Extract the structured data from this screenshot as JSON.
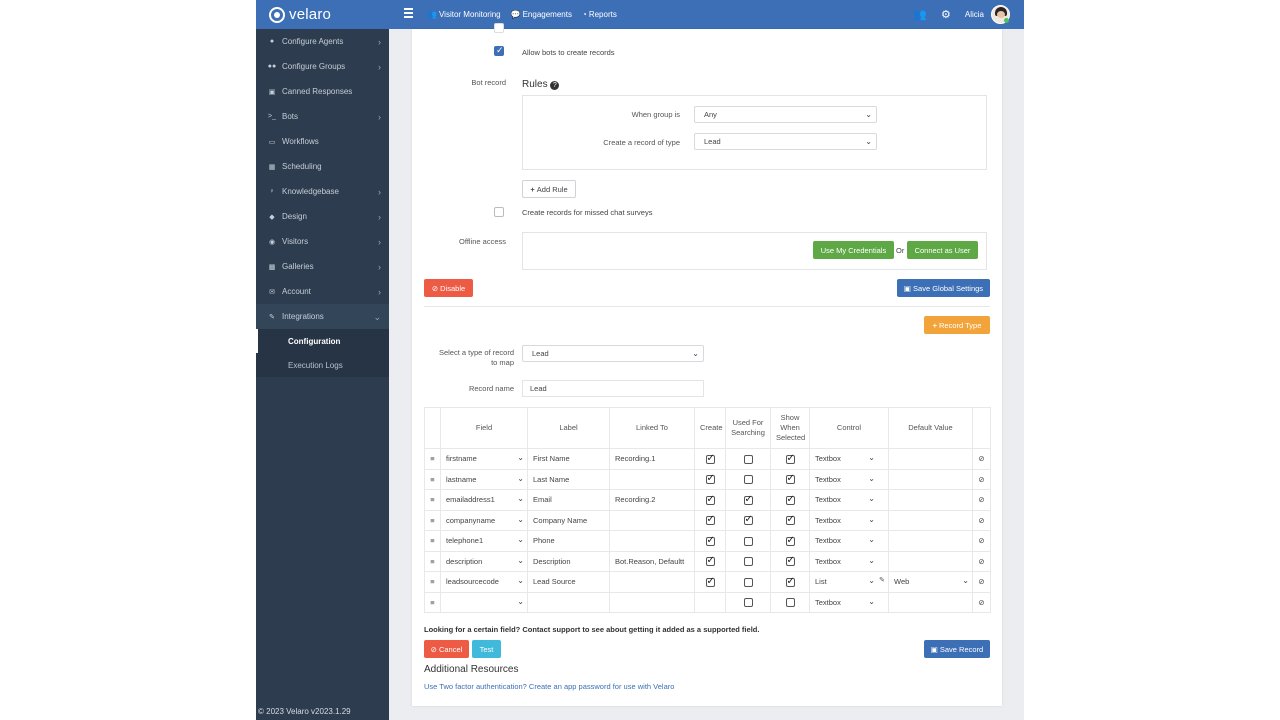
{
  "brand": {
    "name": "velaro"
  },
  "topnav": [
    {
      "label": "Visitor Monitoring",
      "icon": "users-icon"
    },
    {
      "label": "Engagements",
      "icon": "chat-icon"
    },
    {
      "label": "Reports",
      "icon": "chart-icon"
    }
  ],
  "user": {
    "name": "Alicia"
  },
  "sidebar": {
    "items": [
      {
        "label": "Configure Agents",
        "icon": "user-icon",
        "chevron": true
      },
      {
        "label": "Configure Groups",
        "icon": "users-icon",
        "chevron": true
      },
      {
        "label": "Canned Responses",
        "icon": "edit-icon",
        "chevron": false
      },
      {
        "label": "Bots",
        "icon": "terminal-icon",
        "chevron": true
      },
      {
        "label": "Workflows",
        "icon": "keyboard-icon",
        "chevron": false
      },
      {
        "label": "Scheduling",
        "icon": "calendar-icon",
        "chevron": false
      },
      {
        "label": "Knowledgebase",
        "icon": "bulb-icon",
        "chevron": true
      },
      {
        "label": "Design",
        "icon": "diamond-icon",
        "chevron": true
      },
      {
        "label": "Visitors",
        "icon": "eye-icon",
        "chevron": true
      },
      {
        "label": "Galleries",
        "icon": "image-icon",
        "chevron": true
      },
      {
        "label": "Account",
        "icon": "envelope-icon",
        "chevron": true
      },
      {
        "label": "Integrations",
        "icon": "plug-icon",
        "chevron": true
      }
    ],
    "subitems": [
      {
        "label": "Configuration",
        "active": true
      },
      {
        "label": "Execution Logs",
        "active": false
      }
    ],
    "footer": "© 2023 Velaro   v2023.1.29"
  },
  "settings": {
    "allow_bots_label": "Allow bots to create records",
    "bot_record_label": "Bot record",
    "rules_title": "Rules",
    "when_group_label": "When group is",
    "when_group_value": "Any",
    "record_type_label": "Create a record of type",
    "record_type_value": "Lead",
    "add_rule_label": "Add Rule",
    "missed_chat_label": "Create records for missed chat surveys",
    "offline_access_label": "Offline access",
    "use_credentials_label": "Use My Credentials",
    "or_label": "Or",
    "connect_user_label": "Connect as User",
    "disable_label": "Disable",
    "save_global_label": "Save Global Settings"
  },
  "mapping": {
    "record_type_button": "Record Type",
    "select_type_label": "Select a type of record to map",
    "select_type_value": "Lead",
    "record_name_label": "Record name",
    "record_name_value": "Lead",
    "headers": [
      "Field",
      "Label",
      "Linked To",
      "Create",
      "Used For Searching",
      "Show When Selected",
      "Control",
      "Default Value"
    ],
    "rows": [
      {
        "field": "firstname",
        "label": "First Name",
        "linked": "Recording.1",
        "create": true,
        "search": false,
        "show": true,
        "control": "Textbox",
        "default": ""
      },
      {
        "field": "lastname",
        "label": "Last Name",
        "linked": "",
        "create": true,
        "search": false,
        "show": true,
        "control": "Textbox",
        "default": ""
      },
      {
        "field": "emailaddress1",
        "label": "Email",
        "linked": "Recording.2",
        "create": true,
        "search": true,
        "show": true,
        "control": "Textbox",
        "default": ""
      },
      {
        "field": "companyname",
        "label": "Company Name",
        "linked": "",
        "create": true,
        "search": true,
        "show": true,
        "control": "Textbox",
        "default": ""
      },
      {
        "field": "telephone1",
        "label": "Phone",
        "linked": "",
        "create": true,
        "search": false,
        "show": true,
        "control": "Textbox",
        "default": ""
      },
      {
        "field": "description",
        "label": "Description",
        "linked": "Bot.Reason, Defaultt",
        "create": true,
        "search": false,
        "show": true,
        "control": "Textbox",
        "default": ""
      },
      {
        "field": "leadsourcecode",
        "label": "Lead Source",
        "linked": "",
        "create": true,
        "search": false,
        "show": true,
        "control": "List",
        "default": "Web"
      },
      {
        "field": "",
        "label": "",
        "linked": "",
        "create": null,
        "search": false,
        "show": false,
        "control": "Textbox",
        "default": ""
      }
    ],
    "notice": "Looking for a certain field? Contact support to see about getting it added as a supported field.",
    "cancel_label": "Cancel",
    "test_label": "Test",
    "save_record_label": "Save Record"
  },
  "resources": {
    "title": "Additional Resources",
    "link": "Use Two factor authentication? Create an app password for use with Velaro"
  },
  "colors": {
    "primary": "#3c6fb5",
    "sidebar": "#2d3c4e",
    "danger": "#ee5b45",
    "success": "#5fa846",
    "warning": "#f2a43a",
    "info": "#41b9da"
  }
}
